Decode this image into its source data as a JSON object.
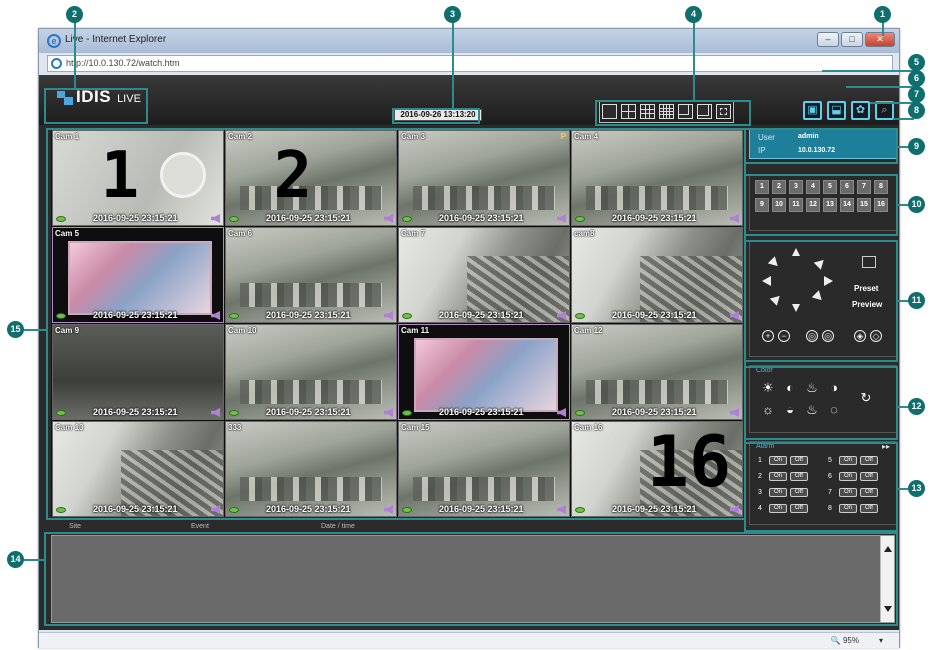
{
  "browser": {
    "window_title": "Live - Internet Explorer",
    "url": "http://10.0.130.72/watch.htm",
    "zoom": "95%"
  },
  "app": {
    "logo_text": "IDIS",
    "logo_sub": "LIVE",
    "datetime": "2016-09-26 13:13:20",
    "layout_buttons": [
      "single",
      "2x2",
      "3x3",
      "4x4",
      "1+5",
      "1+7",
      "fullscreen"
    ],
    "tool_buttons": [
      "snapshot-icon",
      "export-icon",
      "settings-icon",
      "search-icon"
    ]
  },
  "cameras": [
    {
      "label": "Cam 1",
      "time": "2016-09-25 23:15:21",
      "feed": "clock",
      "overlay": "1"
    },
    {
      "label": "Cam 2",
      "time": "2016-09-25 23:15:21",
      "feed": "office",
      "overlay": "2"
    },
    {
      "label": "Cam 3",
      "time": "2016-09-25 23:15:21",
      "feed": "office",
      "badge": "P"
    },
    {
      "label": "Cam 4",
      "time": "2016-09-25 23:15:21",
      "feed": "office"
    },
    {
      "label": "Cam 5",
      "time": "2016-09-25 23:15:21",
      "feed": "car"
    },
    {
      "label": "Cam 6",
      "time": "2016-09-25 23:15:21",
      "feed": "office"
    },
    {
      "label": "Cam 7",
      "time": "2016-09-25 23:15:21",
      "feed": "roof"
    },
    {
      "label": "cam8",
      "time": "2016-09-25 23:15:21",
      "feed": "roof"
    },
    {
      "label": "Cam 9",
      "time": "2016-09-25 23:15:21",
      "feed": "dark"
    },
    {
      "label": "Cam 10",
      "time": "2016-09-25 23:15:21",
      "feed": "office"
    },
    {
      "label": "Cam 11",
      "time": "2016-09-25 23:15:21",
      "feed": "car"
    },
    {
      "label": "Cam 12",
      "time": "2016-09-25 23:15:21",
      "feed": "office"
    },
    {
      "label": "Cam 13",
      "time": "2016-09-25 23:15:21",
      "feed": "roof"
    },
    {
      "label": "333",
      "time": "2016-09-25 23:15:21",
      "feed": "office"
    },
    {
      "label": "Cam 15",
      "time": "2016-09-25 23:15:21",
      "feed": "office"
    },
    {
      "label": "Cam 16",
      "time": "2016-09-25 23:15:21",
      "feed": "roof",
      "overlay": "16"
    }
  ],
  "user_panel": {
    "user_label": "User",
    "user_value": "admin",
    "ip_label": "IP",
    "ip_value": "10.0.130.72"
  },
  "channels": [
    "1",
    "2",
    "3",
    "4",
    "5",
    "6",
    "7",
    "8",
    "9",
    "10",
    "11",
    "12",
    "13",
    "14",
    "15",
    "16"
  ],
  "ptz": {
    "preset_label": "Preset",
    "preview_label": "Preview"
  },
  "color_panel": {
    "title": "Color"
  },
  "alarm_panel": {
    "title": "Alarm",
    "on_label": "On",
    "off_label": "Off",
    "outputs": [
      "1",
      "2",
      "3",
      "4",
      "5",
      "6",
      "7",
      "8"
    ]
  },
  "event_log": {
    "columns": [
      "Site",
      "Event",
      "Date / time"
    ]
  },
  "callouts": [
    "1",
    "2",
    "3",
    "4",
    "5",
    "6",
    "7",
    "8",
    "9",
    "10",
    "11",
    "12",
    "13",
    "14",
    "15"
  ],
  "colors": {
    "accent": "#5bd0f2",
    "callout": "#0f6e6e",
    "user_panel": "#1e7f9a"
  }
}
